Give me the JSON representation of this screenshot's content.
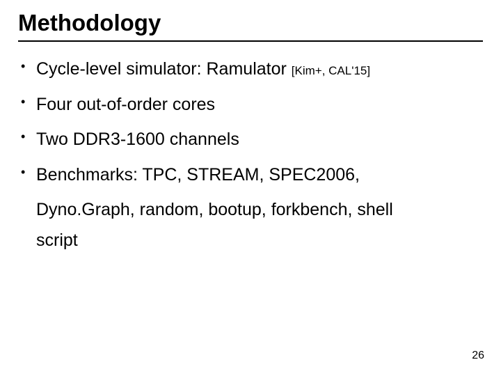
{
  "title": "Methodology",
  "bullets": [
    {
      "text": "Cycle-level simulator: Ramulator ",
      "bold": false,
      "cite": "[Kim+, CAL'15]"
    },
    {
      "text": "Four out-of-order cores",
      "bold": true
    },
    {
      "text": "Two DDR3-1600 channels",
      "bold": true
    },
    {
      "text": "Benchmarks: TPC, STREAM, SPEC2006,",
      "bold": false,
      "cont": [
        "Dyno.Graph, random, bootup, forkbench, shell",
        "script"
      ]
    }
  ],
  "page_number": "26"
}
